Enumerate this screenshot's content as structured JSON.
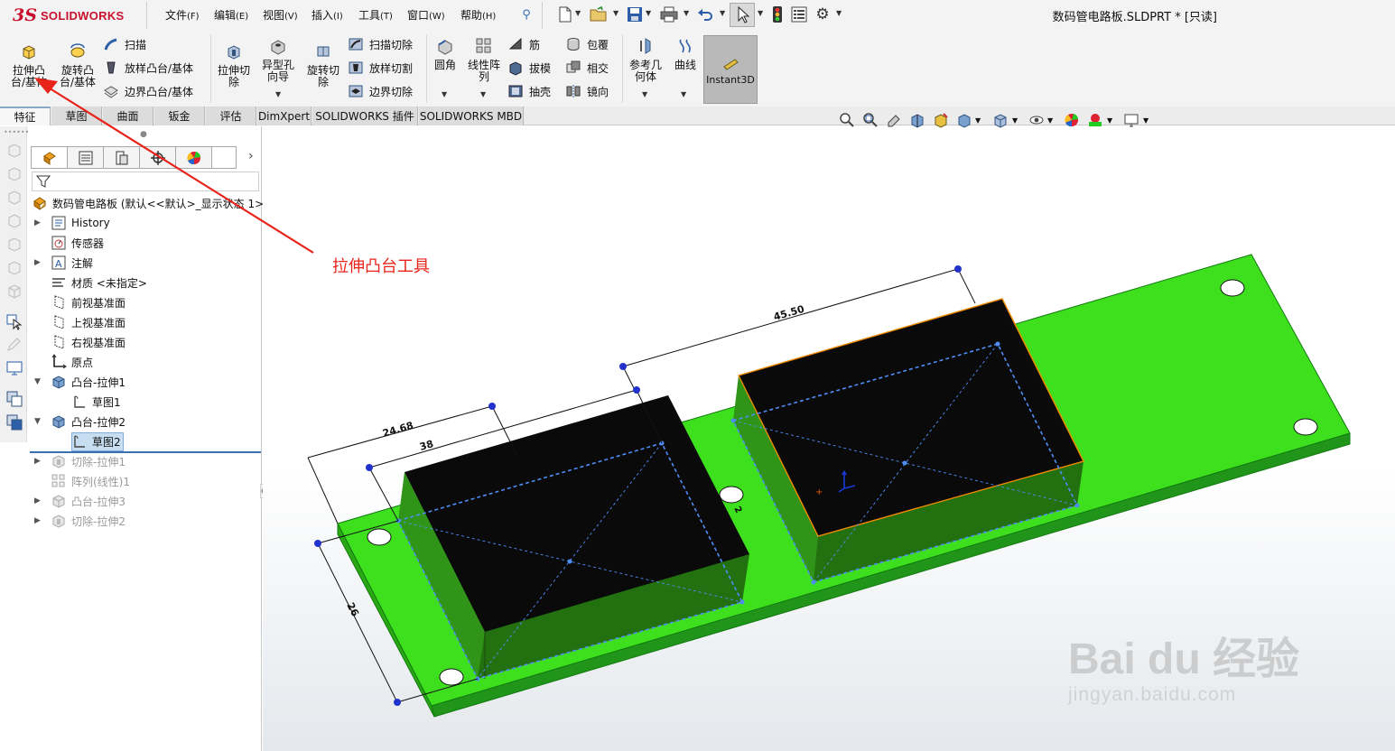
{
  "app": {
    "logo_text": "SOLIDWORKS",
    "logo_prefix": "3S"
  },
  "menu": [
    {
      "label": "文件",
      "key": "(F)"
    },
    {
      "label": "编辑",
      "key": "(E)"
    },
    {
      "label": "视图",
      "key": "(V)"
    },
    {
      "label": "插入",
      "key": "(I)"
    },
    {
      "label": "工具",
      "key": "(T)"
    },
    {
      "label": "窗口",
      "key": "(W)"
    },
    {
      "label": "帮助",
      "key": "(H)"
    }
  ],
  "document_title": "数码管电路板.SLDPRT * [只读]",
  "ribbon": {
    "extrude_boss": "拉伸凸\n台/基体",
    "revolve_boss": "旋转凸\n台/基体",
    "sweep": "扫描",
    "loft_boss": "放样凸台/基体",
    "boundary_boss": "边界凸台/基体",
    "extrude_cut": "拉伸切\n除",
    "hole_wizard": "异型孔\n向导",
    "revolve_cut": "旋转切\n除",
    "swept_cut": "扫描切除",
    "lofted_cut": "放样切割",
    "boundary_cut": "边界切除",
    "fillet": "圆角",
    "linear_pattern": "线性阵\n列",
    "rib": "筋",
    "draft": "拔模",
    "shell": "抽壳",
    "wrap": "包覆",
    "intersect": "相交",
    "mirror": "镜向",
    "ref_geometry": "参考几\n何体",
    "curves": "曲线",
    "instant3d": "Instant3D"
  },
  "tabs": [
    "特征",
    "草图",
    "曲面",
    "钣金",
    "评估",
    "DimXpert",
    "SOLIDWORKS 插件",
    "SOLIDWORKS MBD"
  ],
  "active_tab": "特征",
  "tree": {
    "root": "数码管电路板  (默认<<默认>_显示状态 1>)",
    "items": [
      {
        "label": "History",
        "icon": "history-icon"
      },
      {
        "label": "传感器",
        "icon": "sensor-icon"
      },
      {
        "label": "注解",
        "icon": "annotation-icon"
      },
      {
        "label": "材质 <未指定>",
        "icon": "material-icon"
      },
      {
        "label": "前视基准面",
        "icon": "plane-icon"
      },
      {
        "label": "上视基准面",
        "icon": "plane-icon"
      },
      {
        "label": "右视基准面",
        "icon": "plane-icon"
      },
      {
        "label": "原点",
        "icon": "origin-icon"
      },
      {
        "label": "凸台-拉伸1",
        "icon": "extrude-icon"
      },
      {
        "label": "草图1",
        "icon": "sketch-icon"
      },
      {
        "label": "凸台-拉伸2",
        "icon": "extrude-icon"
      },
      {
        "label": "草图2",
        "icon": "sketch-icon"
      },
      {
        "label": "切除-拉伸1",
        "icon": "cut-icon"
      },
      {
        "label": "阵列(线性)1",
        "icon": "pattern-icon"
      },
      {
        "label": "凸台-拉伸3",
        "icon": "extrude-icon"
      },
      {
        "label": "切除-拉伸2",
        "icon": "cut-icon"
      }
    ]
  },
  "annotation": {
    "text": "拉伸凸台工具",
    "color": "#e8231a"
  },
  "dimensions": {
    "d1": "24.68",
    "d2": "38",
    "d3": "45.50",
    "d4": "26",
    "d5": "2"
  },
  "colors": {
    "board": "#3bdc1e",
    "block": "#0a0a0a",
    "selection": "#f08a00",
    "sketch": "#4f8df5",
    "arrow": "#e8231a"
  },
  "watermark": {
    "line1": "Bai du 经验",
    "line2": "jingyan.baidu.com"
  }
}
